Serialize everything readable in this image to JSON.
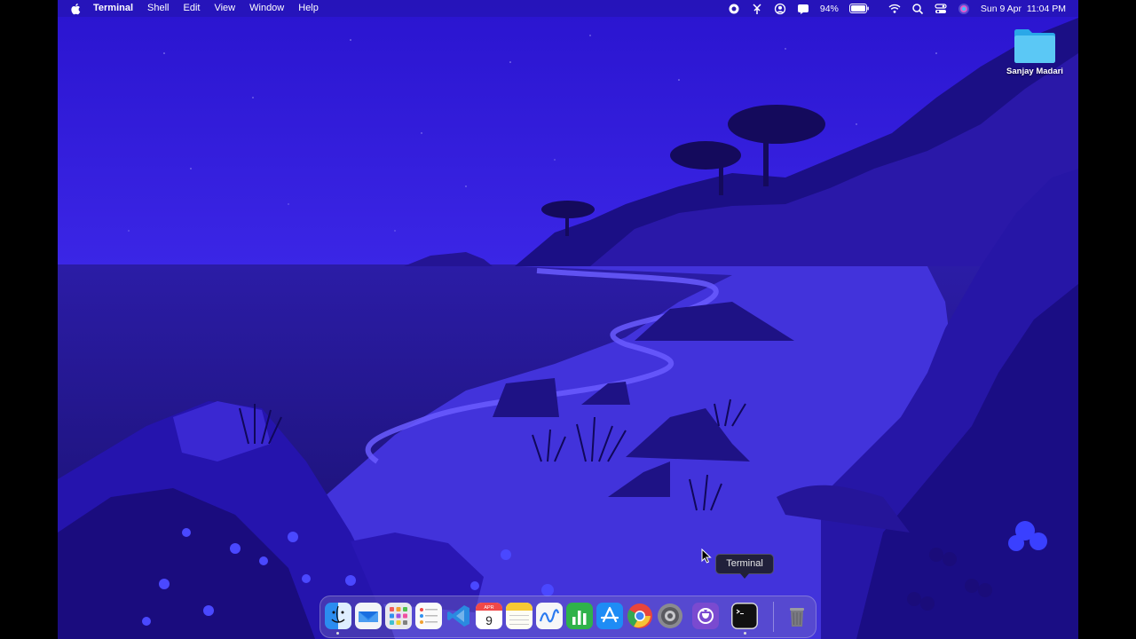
{
  "menubar": {
    "app_name": "Terminal",
    "menus": [
      "Shell",
      "Edit",
      "View",
      "Window",
      "Help"
    ],
    "battery": "94%",
    "datetime": "Sun 9 Apr  11:04 PM"
  },
  "desktop": {
    "folder_label": "Sanjay Madari"
  },
  "dock": {
    "tooltip": "Terminal",
    "calendar_month": "APR",
    "calendar_day": "9",
    "apps": [
      "finder",
      "mail",
      "launchpad",
      "reminders",
      "vscode",
      "calendar",
      "notes",
      "freeform",
      "numbers",
      "app-store",
      "chrome",
      "system-settings",
      "github-desktop",
      "terminal",
      "trash"
    ]
  },
  "colors": {
    "wallpaper_sky": "#3520d8",
    "wallpaper_sea": "#2a1aa8",
    "sand": "#4a3ce8"
  }
}
